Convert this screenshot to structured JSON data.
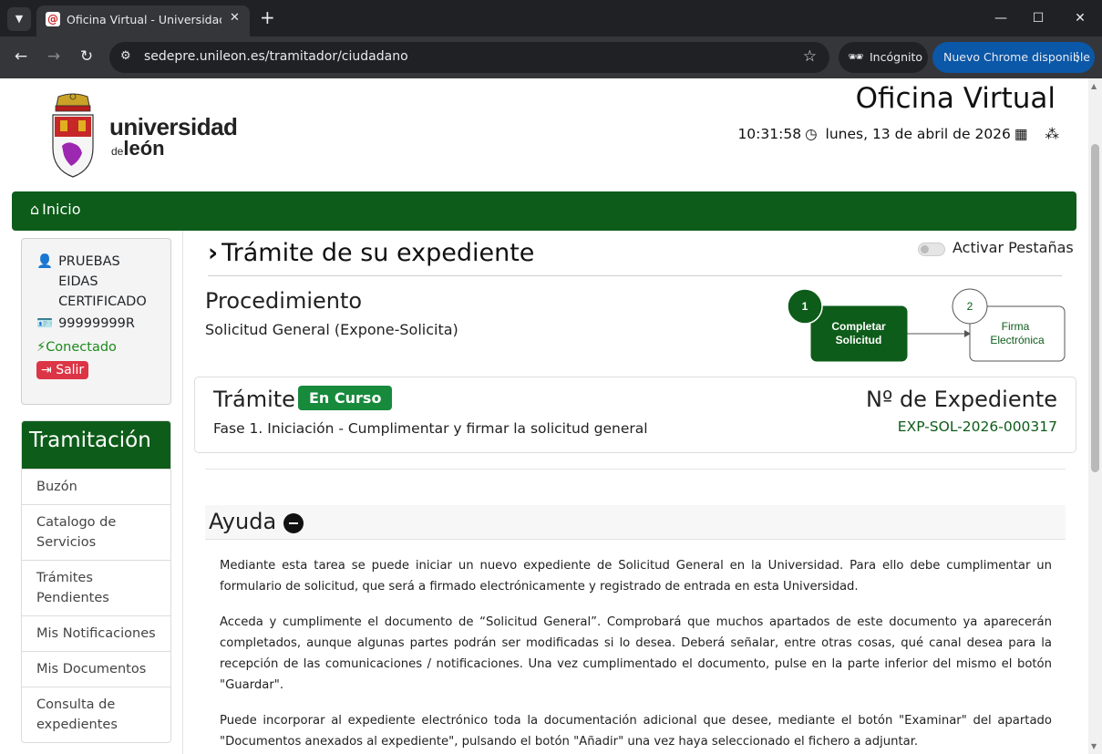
{
  "browser": {
    "tab_title": "Oficina Virtual - Universidad de León",
    "url": "sedepre.unileon.es/tramitador/ciudadano",
    "incognito_label": "Incógnito",
    "update_label": "Nuevo Chrome disponible"
  },
  "header": {
    "logo_line1": "universidad",
    "logo_de": "de",
    "logo_line2": "león",
    "site_title": "Oficina Virtual",
    "time": "10:31:58",
    "date": "lunes, 13 de abril de 2026"
  },
  "nav": {
    "home_label": "Inicio"
  },
  "user": {
    "name": "PRUEBAS EIDAS  CERTIFICADO",
    "id_number": "99999999R",
    "status": "Conectado",
    "logout_label": "Salir"
  },
  "sidebar": {
    "title": "Tramitación",
    "items": [
      {
        "label": "Buzón"
      },
      {
        "label": "Catalogo de Servicios"
      },
      {
        "label": "Trámites Pendientes"
      },
      {
        "label": "Mis Notificaciones"
      },
      {
        "label": "Mis Documentos"
      },
      {
        "label": "Consulta de expedientes"
      }
    ]
  },
  "main": {
    "title": "Trámite de su expediente",
    "tabs_toggle_label": "Activar Pestañas",
    "procedure_label": "Procedimiento",
    "procedure_value": "Solicitud General (Expone-Solicita)",
    "steps": [
      {
        "number": "1",
        "line1": "Completar",
        "line2": "Solicitud",
        "active": true
      },
      {
        "number": "2",
        "line1": "Firma",
        "line2": "Electrónica",
        "active": false
      }
    ],
    "tramite": {
      "label": "Trámite",
      "status_badge": "En Curso",
      "phase": "Fase 1. Iniciación - Cumplimentar y firmar la solicitud general",
      "expediente_label": "Nº de Expediente",
      "expediente_value": "EXP-SOL-2026-000317"
    },
    "help": {
      "title": "Ayuda",
      "paragraphs": [
        "Mediante esta tarea se puede iniciar un nuevo expediente de Solicitud General en la Universidad. Para ello debe cumplimentar un formulario de solicitud, que será a firmado electrónicamente y registrado de entrada en esta Universidad.",
        "Acceda y cumplimente el documento de “Solicitud General”. Comprobará que muchos apartados de este documento ya aparecerán completados, aunque algunas partes podrán ser modificadas si lo desea. Deberá señalar, entre otras cosas, qué canal desea para la recepción de las comunicaciones / notificaciones. Una vez cumplimentado el documento, pulse en la parte inferior del mismo el botón \"Guardar\".",
        "Puede incorporar al expediente electrónico toda la documentación adicional que desee, mediante el botón \"Examinar\" del apartado \"Documentos anexados al expediente\", pulsando el botón \"Añadir\" una vez haya seleccionado el fichero a adjuntar."
      ]
    }
  },
  "colors": {
    "brand_green": "#0d5c19",
    "badge_green": "#178a3c",
    "danger": "#dc3545"
  }
}
